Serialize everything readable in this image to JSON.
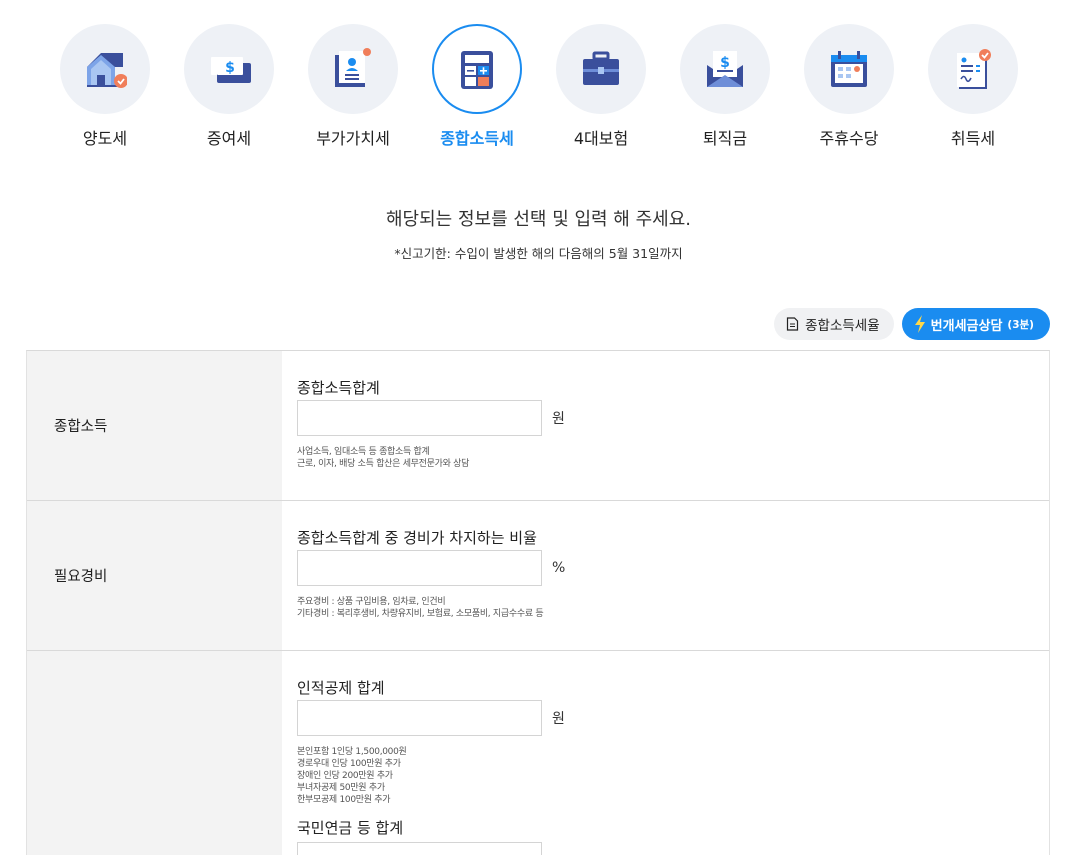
{
  "tabs": [
    {
      "label": "양도세",
      "icon": "house-icon",
      "active": false
    },
    {
      "label": "증여세",
      "icon": "money-bill-icon",
      "active": false
    },
    {
      "label": "부가가치세",
      "icon": "document-icon",
      "active": false
    },
    {
      "label": "종합소득세",
      "icon": "calculator-icon",
      "active": true
    },
    {
      "label": "4대보험",
      "icon": "briefcase-icon",
      "active": false
    },
    {
      "label": "퇴직금",
      "icon": "envelope-money-icon",
      "active": false
    },
    {
      "label": "주휴수당",
      "icon": "calendar-icon",
      "active": false
    },
    {
      "label": "취득세",
      "icon": "contract-icon",
      "active": false
    }
  ],
  "guide": {
    "title": "해당되는 정보를 선택 및 입력 해 주세요.",
    "subtitle": "*신고기한: 수입이 발생한 해의 다음해의 5월 31일까지"
  },
  "actions": {
    "rate_label": "종합소득세율",
    "consult_label": "번개세금상담",
    "consult_suffix": "(3분)"
  },
  "form": {
    "income": {
      "head": "종합소득",
      "label": "종합소득합계",
      "value": "",
      "unit": "원",
      "notes": [
        "사업소득, 임대소득 등 종합소득 합계",
        "근로, 이자, 배당 소득 합산은 세무전문가와 상담"
      ]
    },
    "expense": {
      "head": "필요경비",
      "label": "종합소득합계 중 경비가 차지하는 비율",
      "value": "",
      "unit": "%",
      "notes": [
        "주요경비 : 상품 구입비용, 임차료, 인건비",
        "기타경비 : 복리후생비, 차량유지비, 보험료, 소모품비, 지급수수료 등"
      ]
    },
    "deduction": {
      "head": "",
      "label": "인적공제 합계",
      "value": "",
      "unit": "원",
      "notes": [
        "본인포함 1인당 1,500,000원",
        "경로우대 인당 100만원 추가",
        "장애인 인당 200만원 추가",
        "부녀자공제 50만원 추가",
        "한부모공제 100만원 추가"
      ],
      "next_label": "국민연금 등 합계"
    }
  },
  "colors": {
    "accent": "#1a8cf0",
    "icon_blue": "#3a4f9c",
    "icon_orange": "#f07e5a",
    "tab_bg": "#eef1f6"
  }
}
